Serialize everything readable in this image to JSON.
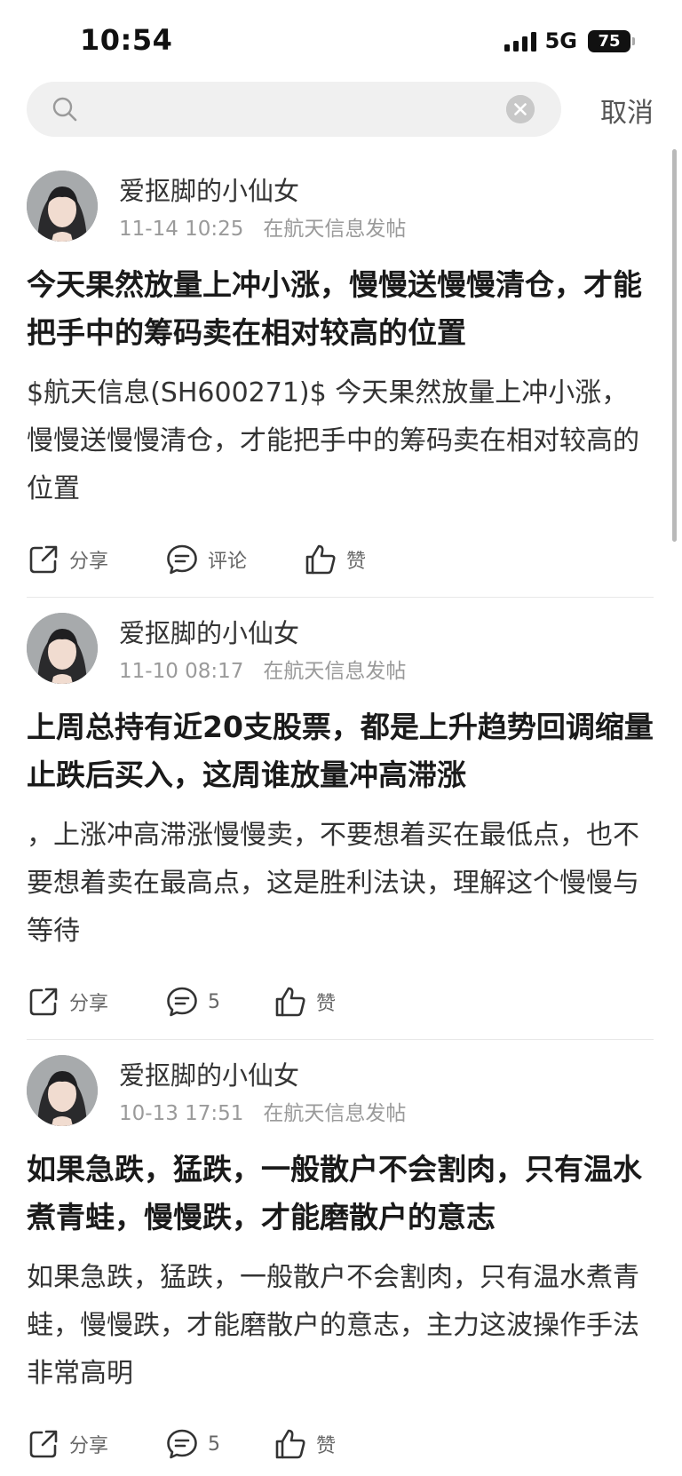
{
  "status_bar": {
    "time": "10:54",
    "network": "5G",
    "battery": "75"
  },
  "search": {
    "value": "",
    "placeholder": "",
    "cancel_label": "取消"
  },
  "posts": [
    {
      "author": "爱抠脚的小仙女",
      "time": "11-14 10:25",
      "location": "在航天信息发帖",
      "title": "今天果然放量上冲小涨，慢慢送慢慢清仓，才能把手中的筹码卖在相对较高的位置",
      "content": "$航天信息(SH600271)$ 今天果然放量上冲小涨，慢慢送慢慢清仓，才能把手中的筹码卖在相对较高的位置",
      "actions": {
        "share": "分享",
        "comment": "评论",
        "like": "赞"
      }
    },
    {
      "author": "爱抠脚的小仙女",
      "time": "11-10 08:17",
      "location": "在航天信息发帖",
      "title": "上周总持有近20支股票，都是上升趋势回调缩量止跌后买入，这周谁放量冲高滞涨",
      "content": "，上涨冲高滞涨慢慢卖，不要想着买在最低点，也不要想着卖在最高点，这是胜利法诀，理解这个慢慢与等待",
      "actions": {
        "share": "分享",
        "comment": "5",
        "like": "赞"
      }
    },
    {
      "author": "爱抠脚的小仙女",
      "time": "10-13 17:51",
      "location": "在航天信息发帖",
      "title": "如果急跌，猛跌，一般散户不会割肉，只有温水煮青蛙，慢慢跌，才能磨散户的意志",
      "content": "如果急跌，猛跌，一般散户不会割肉，只有温水煮青蛙，慢慢跌，才能磨散户的意志，主力这波操作手法非常高明",
      "actions": {
        "share": "分享",
        "comment": "5",
        "like": "赞"
      }
    }
  ]
}
